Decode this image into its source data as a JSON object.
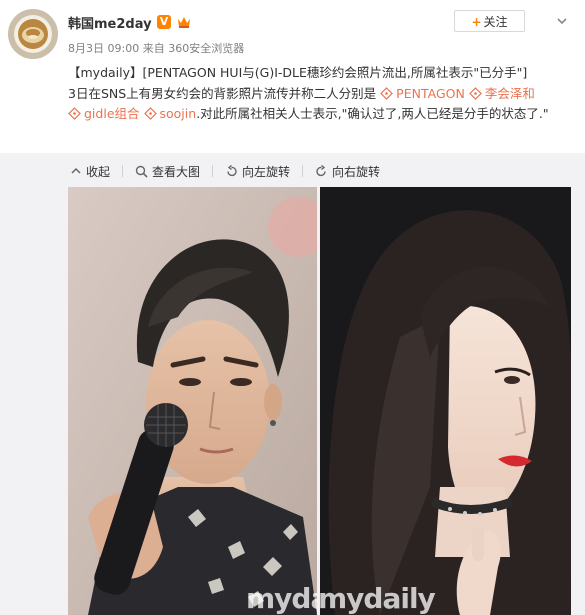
{
  "user": {
    "name": "韩国me2day",
    "verified_badge": "V",
    "crown_icon": "crown-icon",
    "avatar_icon": "latte-art-avatar"
  },
  "meta": {
    "time": "8月3日 09:00",
    "source_prefix": "来自",
    "source": "360安全浏览器"
  },
  "follow": {
    "plus": "+",
    "label": "关注"
  },
  "post": {
    "line1": "【mydaily】[PENTAGON HUI与(G)I-DLE穗珍约会照片流出,所属社表示\"已分手\"]",
    "line2_pre": "3日在SNS上有男女约会的背影照片流传并称二人分别是",
    "topics": [
      "PENTAGON",
      "李会泽和",
      "gidle组合",
      "soojin"
    ],
    "line3_post": ".对此所属社相关人士表示,\"确认过了,两人已经是分手的状态了.\""
  },
  "toolbar": {
    "collapse": "收起",
    "view_large": "查看大图",
    "rotate_left": "向左旋转",
    "rotate_right": "向右旋转"
  },
  "photos": {
    "watermark_left": "mydaily",
    "watermark_right": "mydaily"
  },
  "colors": {
    "accent": "#ff8200",
    "topic": "#eb7350",
    "lipstick": "#d42a2f"
  }
}
